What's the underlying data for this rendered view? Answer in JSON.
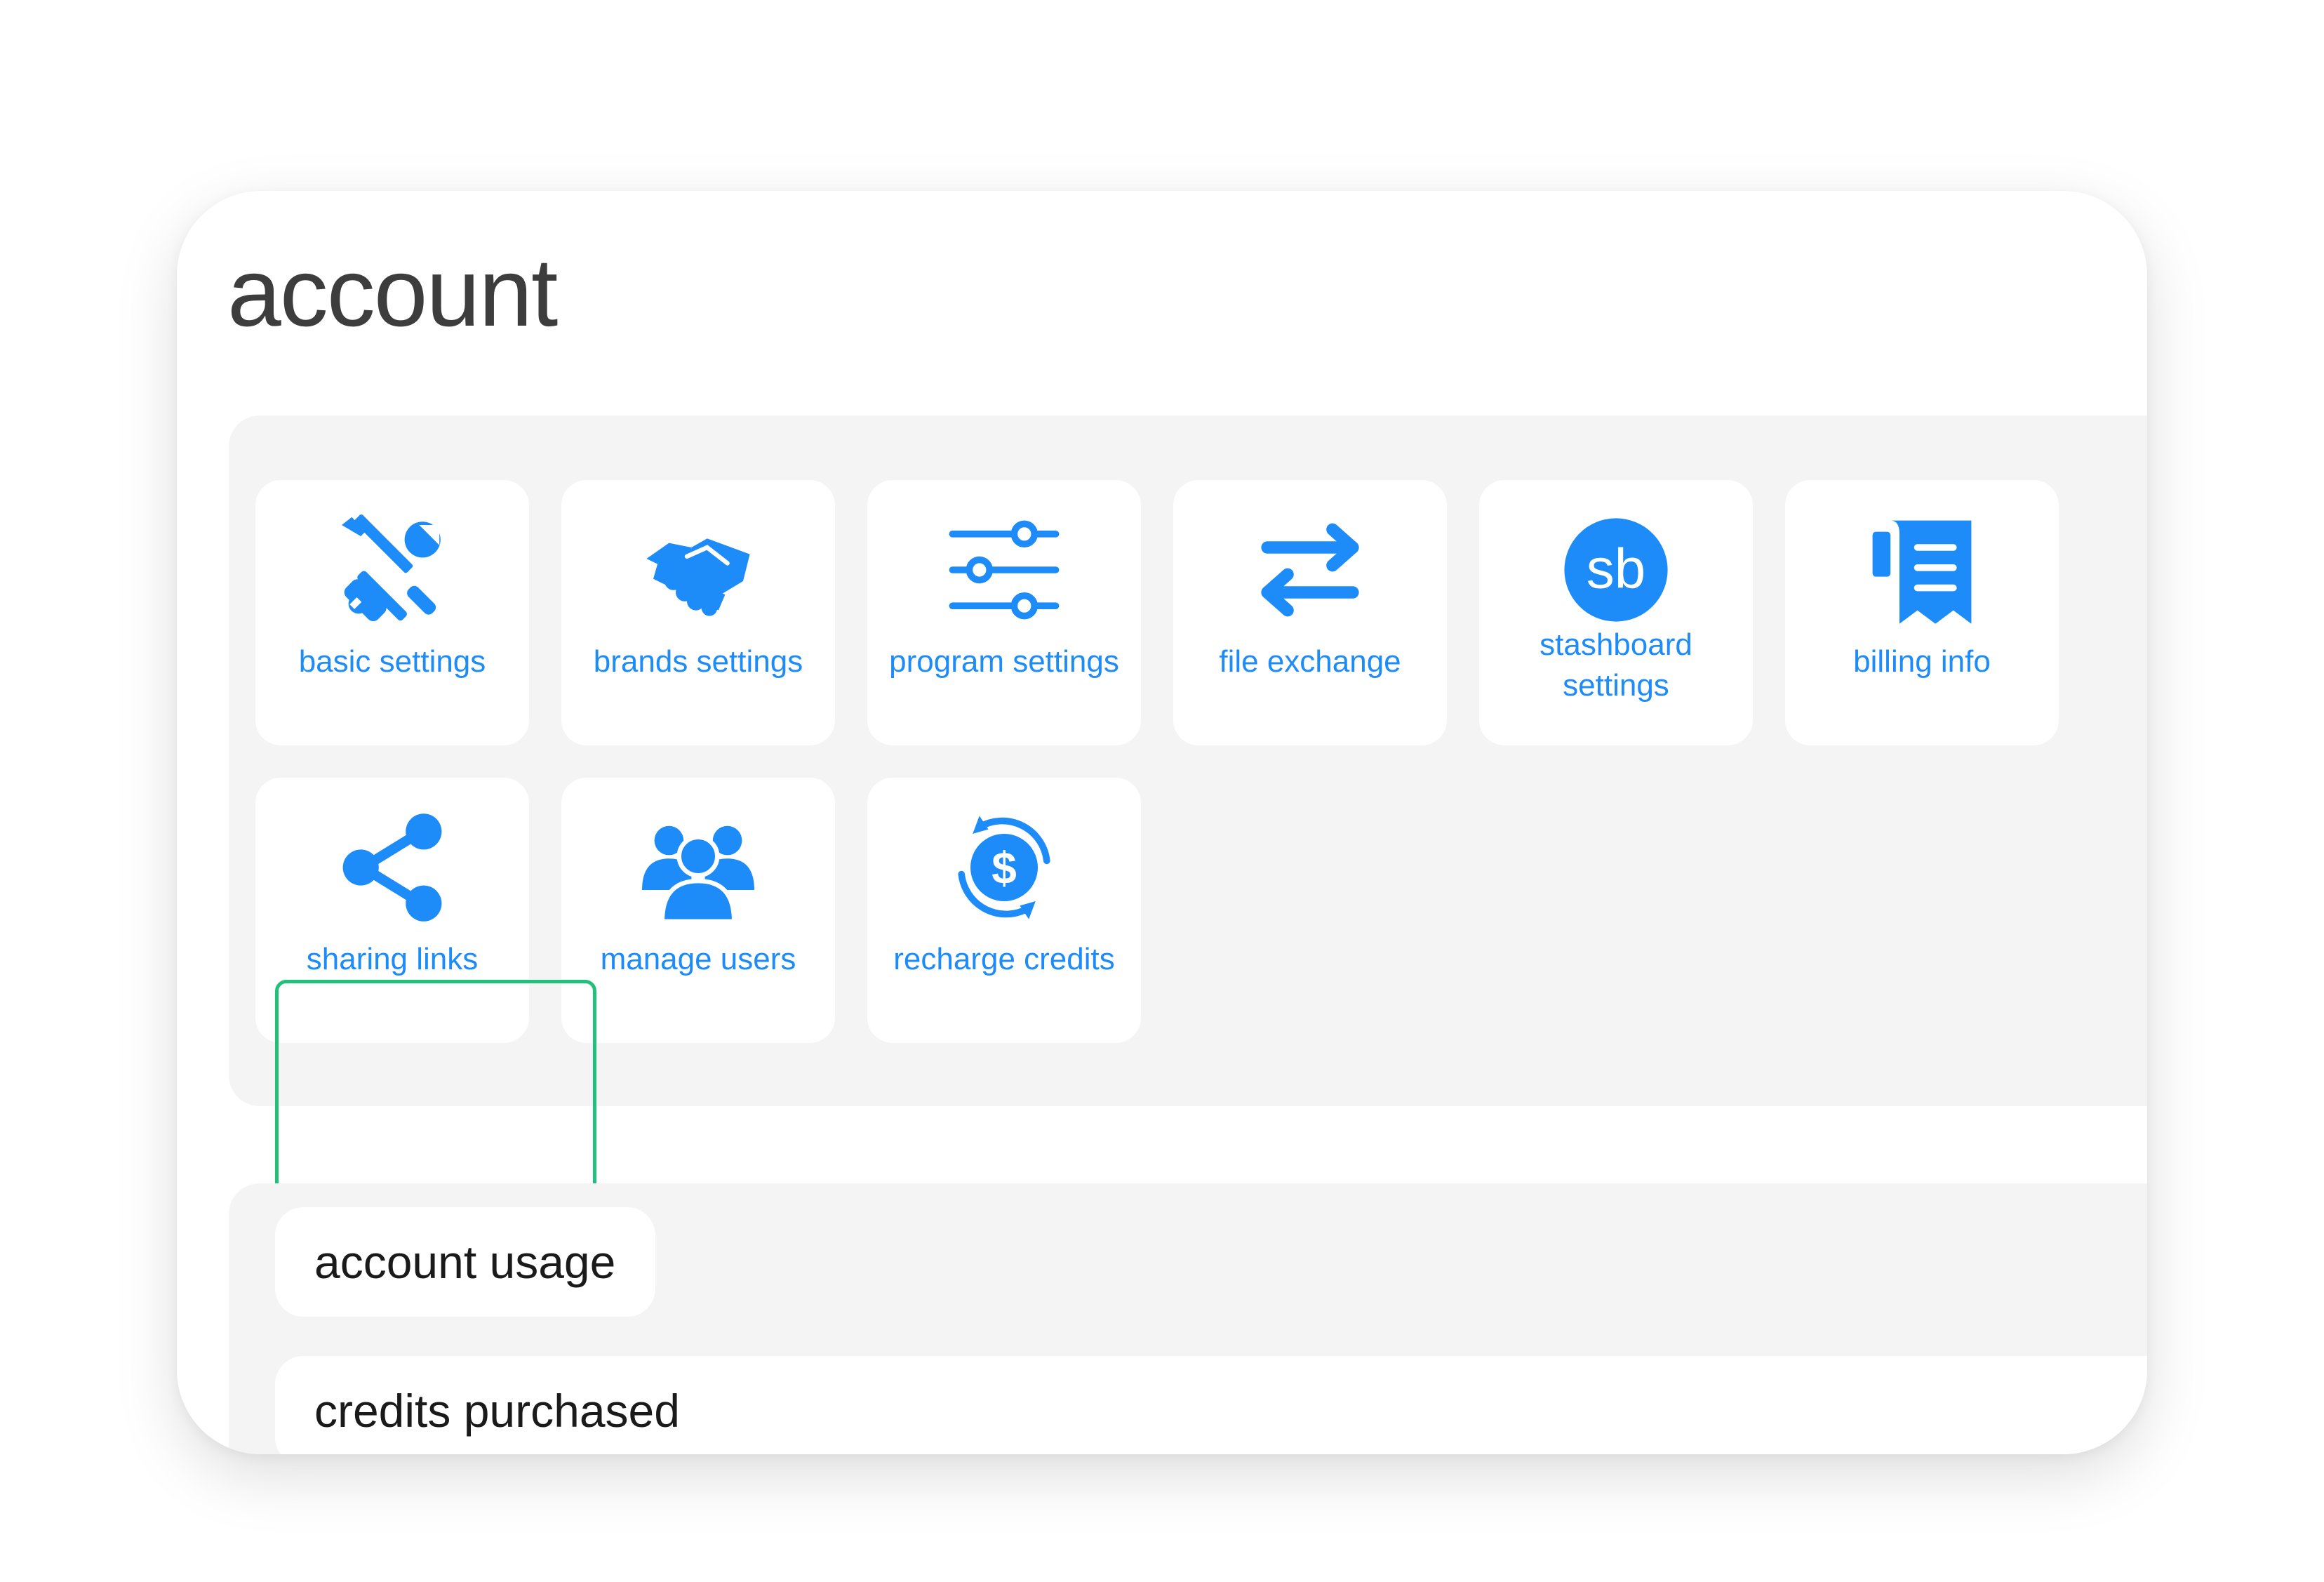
{
  "page": {
    "title": "account"
  },
  "tiles": [
    {
      "label": "basic settings",
      "icon": "tools-icon"
    },
    {
      "label": "brands settings",
      "icon": "handshake-icon"
    },
    {
      "label": "program settings",
      "icon": "sliders-icon"
    },
    {
      "label": "file exchange",
      "icon": "exchange-arrows-icon"
    },
    {
      "label": "stashboard settings",
      "icon": "stashboard-logo-icon",
      "icon_text": "sb"
    },
    {
      "label": "billing info",
      "icon": "receipt-icon"
    },
    {
      "label": "sharing links",
      "icon": "share-icon",
      "highlighted": true
    },
    {
      "label": "manage users",
      "icon": "users-icon"
    },
    {
      "label": "recharge credits",
      "icon": "recharge-dollar-icon"
    }
  ],
  "usage": {
    "account_usage_label": "account usage",
    "credits_purchased_label": "credits purchased"
  },
  "colors": {
    "accent": "#1d8cf8",
    "highlight": "#22c07a",
    "panel_bg": "#f4f4f4",
    "title_text": "#3d3d3d"
  }
}
